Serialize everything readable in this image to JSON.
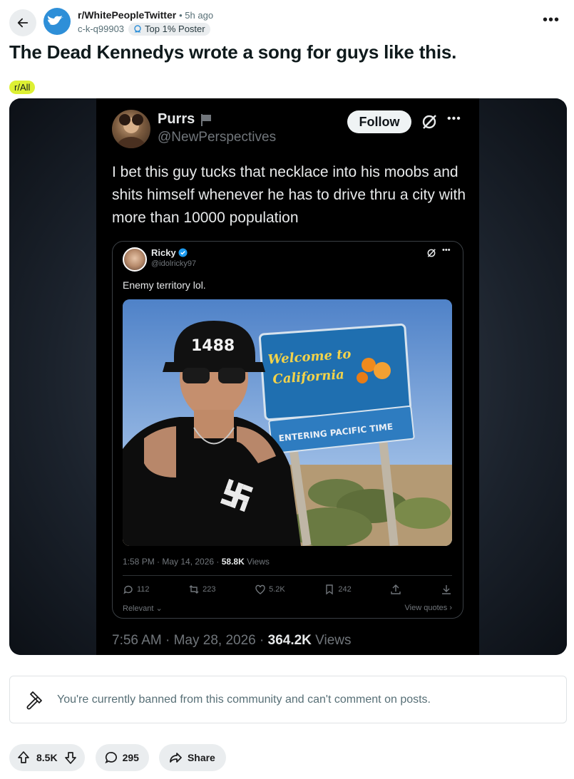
{
  "header": {
    "subreddit": "r/WhitePeopleTwitter",
    "separator": "•",
    "time_ago": "5h ago",
    "author": "c-k-q99903",
    "author_flair": "Top 1% Poster"
  },
  "post": {
    "title": "The Dead Kennedys wrote a song for guys like this.",
    "flair": "r/All"
  },
  "tweet": {
    "name": "Purrs",
    "handle": "@NewPerspectives",
    "follow_label": "Follow",
    "text": "I bet this guy tucks that necklace into his moobs and shits himself whenever he has to drive thru a city with more than 10000 population",
    "timestamp": "7:56 AM · May 28, 2026 · ",
    "views_count": "364.2K",
    "views_label": " Views",
    "quote": {
      "name": "Ricky",
      "handle": "@idolricky97",
      "text": "Enemy territory lol.",
      "photo": {
        "cap_text": "1488",
        "sign_line1": "Welcome to",
        "sign_line2": "California",
        "sign2_text": "ENTERING PACIFIC TIME"
      },
      "timestamp": "1:58 PM · May 14, 2026 · ",
      "views_count": "58.8K",
      "views_label": " Views",
      "replies": "112",
      "reposts": "223",
      "likes": "5.2K",
      "bookmarks": "242",
      "relevant_label": "Relevant",
      "view_quotes_label": "View quotes ›"
    }
  },
  "ban_notice": "You're currently banned from this community and can't comment on posts.",
  "actions": {
    "votes": "8.5K",
    "comments": "295",
    "share_label": "Share"
  },
  "colors": {
    "flair_bg": "#ddf033",
    "subreddit_icon": "#2e8fd8",
    "verified": "#1d9bf0"
  }
}
